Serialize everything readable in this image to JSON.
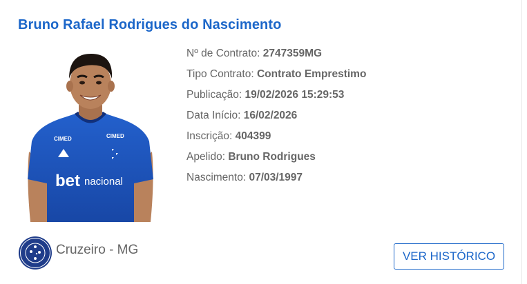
{
  "player": {
    "full_name": "Bruno Rafael Rodrigues do Nascimento"
  },
  "photo": {
    "jersey_sponsor": "betnacional",
    "jersey_brand": "CIMED"
  },
  "details": [
    {
      "label": "Nº de Contrato: ",
      "value": "2747359MG"
    },
    {
      "label": "Tipo Contrato: ",
      "value": "Contrato Emprestimo"
    },
    {
      "label": "Publicação: ",
      "value": "19/02/2026 15:29:53"
    },
    {
      "label": "Data Início: ",
      "value": "16/02/2026"
    },
    {
      "label": "Inscrição: ",
      "value": "404399"
    },
    {
      "label": "Apelido: ",
      "value": "Bruno Rodrigues"
    },
    {
      "label": "Nascimento: ",
      "value": "07/03/1997"
    }
  ],
  "club": {
    "name": "Cruzeiro - MG",
    "logo_text_top": "CRUZEIRO",
    "logo_text_bottom": "ESPORTE CLUBE",
    "logo_icon": "cruzeiro-crest-icon"
  },
  "actions": {
    "history_label": "VER HISTÓRICO"
  },
  "colors": {
    "accent": "#1b66c9",
    "text": "#666666",
    "jersey": "#1a4fb8",
    "club_navy": "#1f3c8a"
  }
}
